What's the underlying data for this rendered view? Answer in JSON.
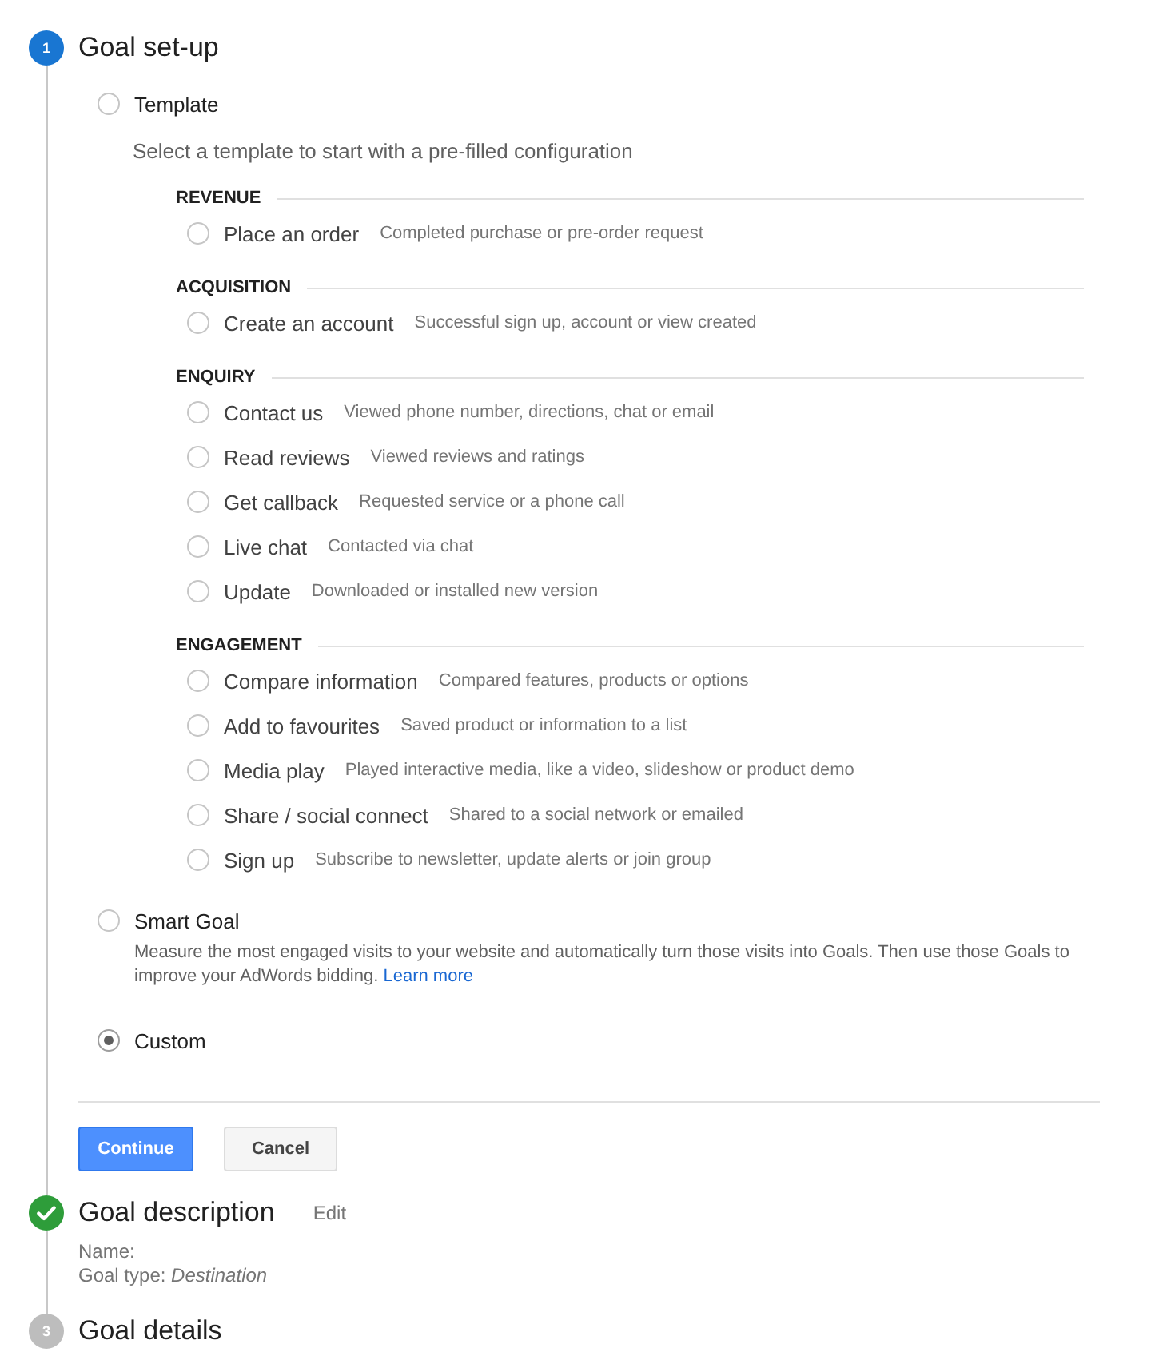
{
  "steps": [
    {
      "kind": "active",
      "number": "1",
      "title": "Goal set-up",
      "goal_types": [
        {
          "kind": "template",
          "label": "Template",
          "selected": false,
          "intro": "Select a template to start with a pre-filled configuration",
          "sections": [
            {
              "heading": "REVENUE",
              "templates": [
                {
                  "name": "Place an order",
                  "description": "Completed purchase or pre-order request",
                  "selected": false
                }
              ]
            },
            {
              "heading": "ACQUISITION",
              "templates": [
                {
                  "name": "Create an account",
                  "description": "Successful sign up, account or view created",
                  "selected": false
                }
              ]
            },
            {
              "heading": "ENQUIRY",
              "templates": [
                {
                  "name": "Contact us",
                  "description": "Viewed phone number, directions, chat or email",
                  "selected": false
                },
                {
                  "name": "Read reviews",
                  "description": "Viewed reviews and ratings",
                  "selected": false
                },
                {
                  "name": "Get callback",
                  "description": "Requested service or a phone call",
                  "selected": false
                },
                {
                  "name": "Live chat",
                  "description": "Contacted via chat",
                  "selected": false
                },
                {
                  "name": "Update",
                  "description": "Downloaded or installed new version",
                  "selected": false
                }
              ]
            },
            {
              "heading": "ENGAGEMENT",
              "templates": [
                {
                  "name": "Compare information",
                  "description": "Compared features, products or options",
                  "selected": false
                },
                {
                  "name": "Add to favourites",
                  "description": "Saved product or information to a list",
                  "selected": false
                },
                {
                  "name": "Media play",
                  "description": "Played interactive media, like a video, slideshow or product demo",
                  "selected": false
                },
                {
                  "name": "Share / social connect",
                  "description": "Shared to a social network or emailed",
                  "selected": false
                },
                {
                  "name": "Sign up",
                  "description": "Subscribe to newsletter, update alerts or join group",
                  "selected": false
                }
              ]
            }
          ]
        },
        {
          "kind": "smart",
          "label": "Smart Goal",
          "selected": false,
          "description": "Measure the most engaged visits to your website and automatically turn those visits into Goals. Then use those Goals to improve your AdWords bidding.",
          "link": "Learn more"
        },
        {
          "kind": "custom",
          "label": "Custom",
          "selected": true
        }
      ],
      "buttons": [
        {
          "kind": "primary",
          "label": "Continue"
        },
        {
          "kind": "secondary",
          "label": "Cancel"
        }
      ]
    },
    {
      "kind": "done",
      "title": "Goal description",
      "action": "Edit",
      "summary": [
        {
          "label": "Name:"
        },
        {
          "label": "Goal type:",
          "value": "Destination"
        }
      ]
    },
    {
      "kind": "pending",
      "number": "3",
      "title": "Goal details"
    }
  ]
}
